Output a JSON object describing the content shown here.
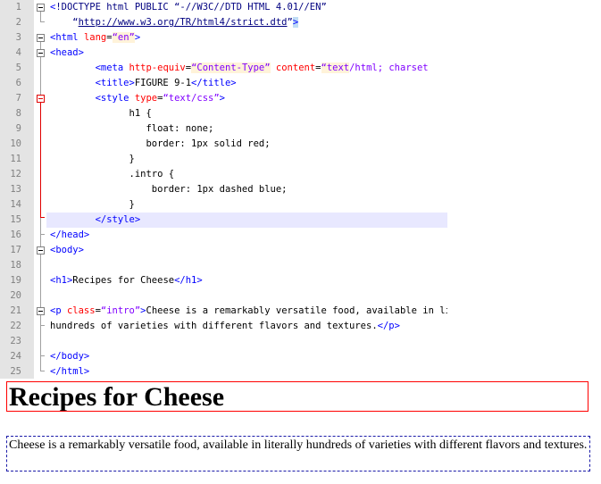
{
  "editor": {
    "lines": [
      {
        "n": "1",
        "segs": [
          {
            "t": "<",
            "c": "t-tag"
          },
          {
            "t": "!DOCTYPE html PUBLIC “-//W3C//DTD HTML 4.01//EN”",
            "c": "t-dt"
          }
        ]
      },
      {
        "n": "2",
        "segs": [
          {
            "t": "    “",
            "c": "t-dt"
          },
          {
            "t": "http://www.w3.org/TR/html4/strict.dtd",
            "c": "t-link"
          },
          {
            "t": "”",
            "c": "t-dt"
          },
          {
            "t": ">",
            "c": "t-tag t-sel"
          }
        ]
      },
      {
        "n": "3",
        "segs": [
          {
            "t": "<html ",
            "c": "t-tag"
          },
          {
            "t": "lang",
            "c": "t-attr"
          },
          {
            "t": "=",
            "c": ""
          },
          {
            "t": "“en”",
            "c": "t-str"
          },
          {
            "t": ">",
            "c": "t-tag"
          }
        ]
      },
      {
        "n": "4",
        "segs": [
          {
            "t": "<head>",
            "c": "t-tag"
          }
        ]
      },
      {
        "n": "5",
        "segs": [
          {
            "t": "        <meta ",
            "c": "t-tag"
          },
          {
            "t": "http-equiv",
            "c": "t-attr"
          },
          {
            "t": "=",
            "c": ""
          },
          {
            "t": "“Content-Type”",
            "c": "t-str"
          },
          {
            "t": " ",
            "c": ""
          },
          {
            "t": "content",
            "c": "t-attr"
          },
          {
            "t": "=",
            "c": ""
          },
          {
            "t": "“text",
            "c": "t-str"
          },
          {
            "t": "/html; charset",
            "c": "t-val"
          }
        ]
      },
      {
        "n": "6",
        "segs": [
          {
            "t": "        <title>",
            "c": "t-tag"
          },
          {
            "t": "FIGURE 9-1",
            "c": ""
          },
          {
            "t": "</title>",
            "c": "t-tag"
          }
        ]
      },
      {
        "n": "7",
        "segs": [
          {
            "t": "        <style ",
            "c": "t-tag"
          },
          {
            "t": "type",
            "c": "t-attr"
          },
          {
            "t": "=",
            "c": ""
          },
          {
            "t": "“text/css”",
            "c": "t-val"
          },
          {
            "t": ">",
            "c": "t-tag"
          }
        ]
      },
      {
        "n": "8",
        "segs": [
          {
            "t": "              h1 {",
            "c": ""
          }
        ]
      },
      {
        "n": "9",
        "segs": [
          {
            "t": "                 float: none;",
            "c": ""
          }
        ]
      },
      {
        "n": "10",
        "segs": [
          {
            "t": "                 border: 1px solid red;",
            "c": ""
          }
        ]
      },
      {
        "n": "11",
        "segs": [
          {
            "t": "              }",
            "c": ""
          }
        ]
      },
      {
        "n": "12",
        "segs": [
          {
            "t": "              .intro {",
            "c": ""
          }
        ]
      },
      {
        "n": "13",
        "segs": [
          {
            "t": "                  border: 1px dashed blue;",
            "c": ""
          }
        ]
      },
      {
        "n": "14",
        "segs": [
          {
            "t": "              }",
            "c": ""
          }
        ]
      },
      {
        "n": "15",
        "segs": [
          {
            "t": "        </style>",
            "c": "t-tag"
          }
        ]
      },
      {
        "n": "16",
        "segs": [
          {
            "t": "</head>",
            "c": "t-tag"
          }
        ]
      },
      {
        "n": "17",
        "segs": [
          {
            "t": "<body>",
            "c": "t-tag"
          }
        ]
      },
      {
        "n": "18",
        "segs": []
      },
      {
        "n": "19",
        "segs": [
          {
            "t": "<h1>",
            "c": "t-tag"
          },
          {
            "t": "Recipes for Cheese",
            "c": ""
          },
          {
            "t": "</h1>",
            "c": "t-tag"
          }
        ]
      },
      {
        "n": "20",
        "segs": []
      },
      {
        "n": "21",
        "segs": [
          {
            "t": "<p ",
            "c": "t-tag"
          },
          {
            "t": "class",
            "c": "t-attr"
          },
          {
            "t": "=",
            "c": ""
          },
          {
            "t": "“intro”",
            "c": "t-val"
          },
          {
            "t": ">",
            "c": "t-tag"
          },
          {
            "t": "Cheese is a remarkably versatile food, available in literally",
            "c": ""
          }
        ]
      },
      {
        "n": "22",
        "segs": [
          {
            "t": "hundreds of varieties with different flavors and textures.",
            "c": ""
          },
          {
            "t": "</p>",
            "c": "t-tag"
          }
        ]
      },
      {
        "n": "23",
        "segs": []
      },
      {
        "n": "24",
        "segs": [
          {
            "t": "</body>",
            "c": "t-tag"
          }
        ]
      },
      {
        "n": "25",
        "segs": [
          {
            "t": "</html>",
            "c": "t-tag"
          }
        ]
      }
    ]
  },
  "preview": {
    "heading": "Recipes for Cheese",
    "intro": "Cheese is a remarkably versatile food, available in literally hundreds of varieties with different flavors and textures."
  }
}
